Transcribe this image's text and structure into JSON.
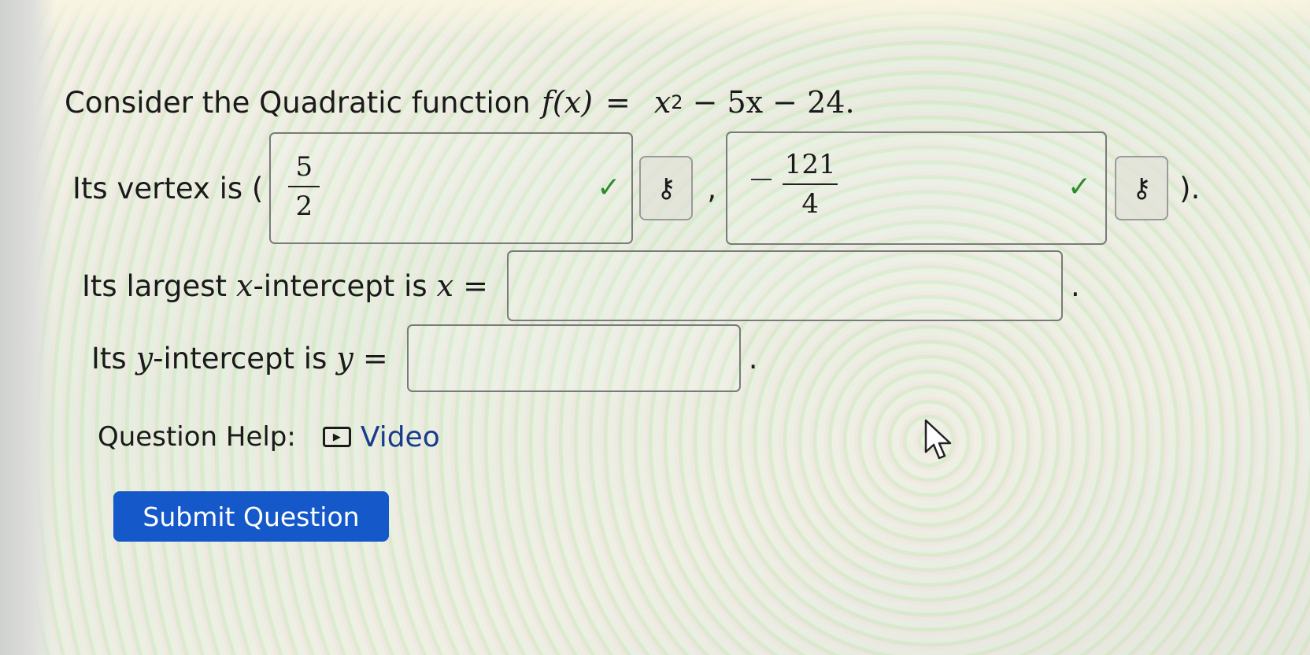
{
  "question": {
    "intro": "Consider the Quadratic function",
    "function_lhs": "f(x)",
    "equals": "=",
    "function_rhs_base": "x",
    "function_rhs_exp": "2",
    "function_rhs_rest": "− 5x − 24."
  },
  "vertex": {
    "label": "Its vertex is (",
    "x_answer": {
      "numerator": "5",
      "denominator": "2",
      "status_icon": "check-icon"
    },
    "comma": ",",
    "y_answer": {
      "sign": "−",
      "numerator": "121",
      "denominator": "4",
      "status_icon": "check-icon"
    },
    "close": ").",
    "key_icon": "key-icon"
  },
  "x_intercept": {
    "label_prefix": "Its largest",
    "var": "x",
    "label_suffix": "-intercept is",
    "eq": "x =",
    "value": "",
    "period": "."
  },
  "y_intercept": {
    "label_prefix": "Its",
    "var": "y",
    "label_suffix": "-intercept is",
    "eq": "y =",
    "value": "",
    "period": "."
  },
  "help": {
    "label": "Question Help:",
    "video_icon": "play-icon",
    "video_label": "Video"
  },
  "submit_label": "Submit Question",
  "colors": {
    "submit_bg": "#1558c9",
    "check": "#2f8a2f",
    "link": "#1a3b8c"
  }
}
